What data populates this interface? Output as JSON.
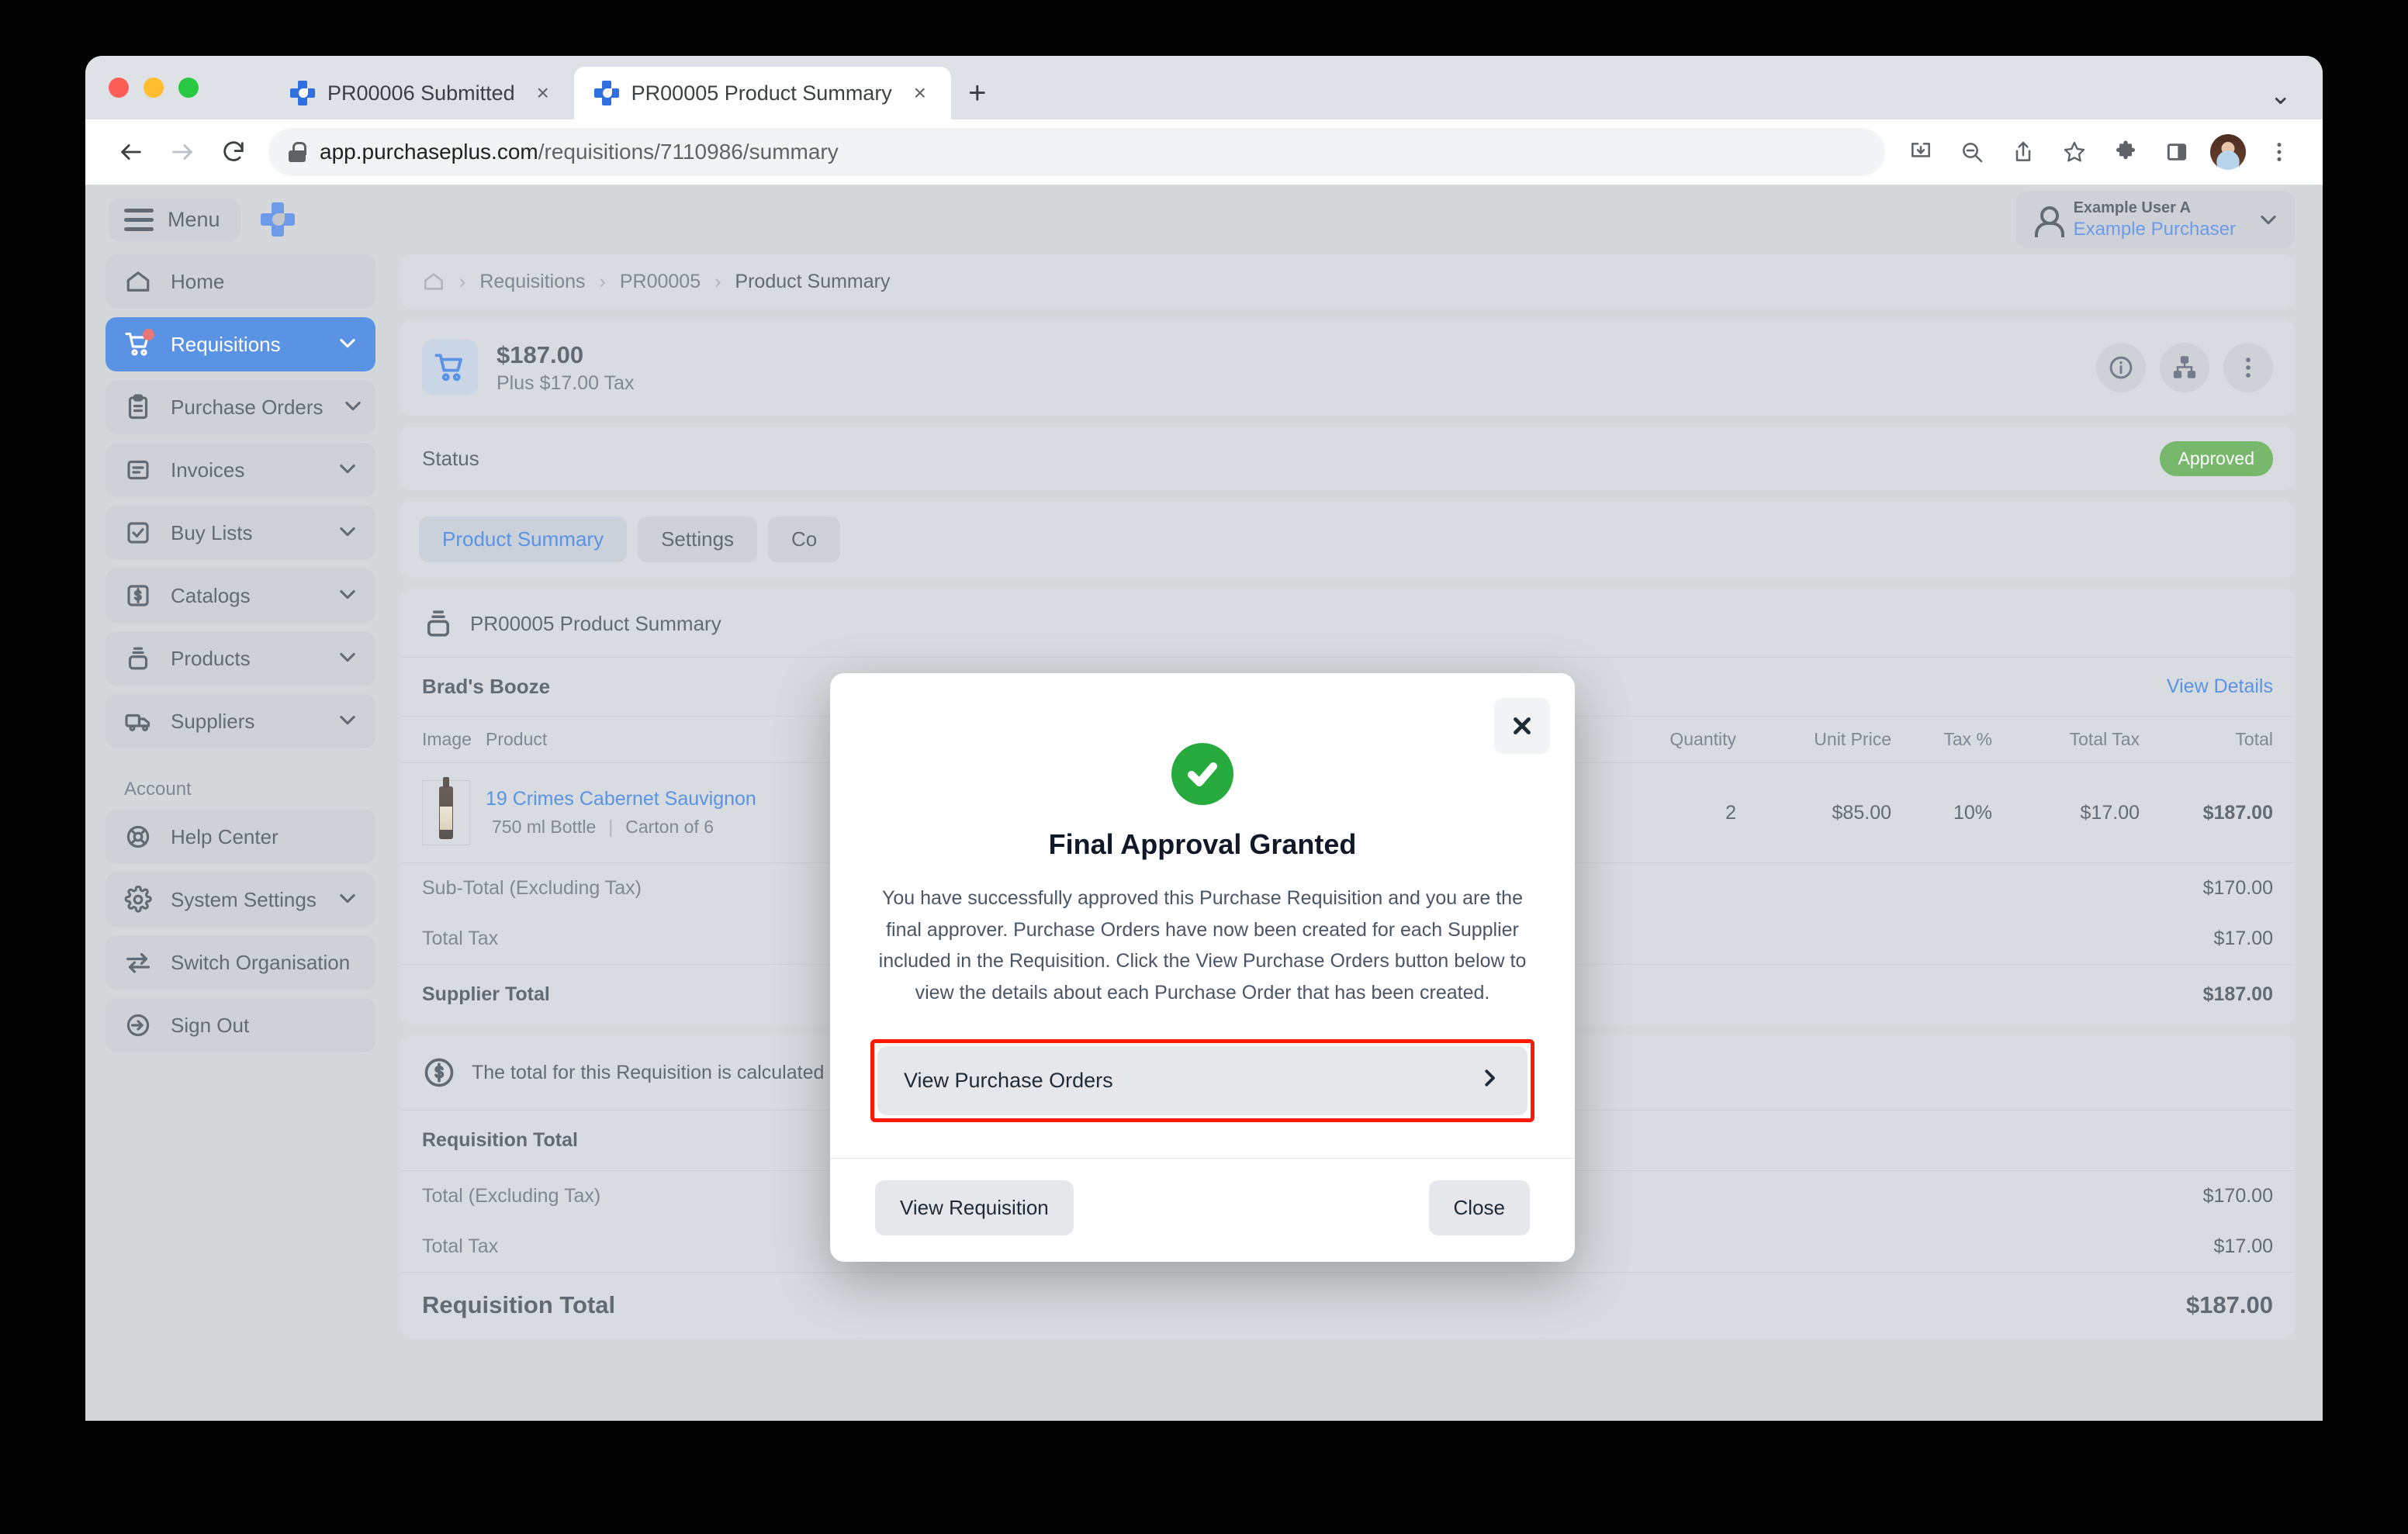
{
  "browser": {
    "tabs": [
      {
        "title": "PR00006 Submitted",
        "active": false,
        "close_label": "×"
      },
      {
        "title": "PR00005 Product Summary",
        "active": true,
        "close_label": "×"
      }
    ],
    "new_tab_label": "+",
    "url_host": "app.purchaseplus.com",
    "url_path": "/requisitions/7110986/summary",
    "toolbar_icons": [
      "install-icon",
      "zoom-out-icon",
      "share-icon",
      "bookmark-star-icon",
      "extensions-puzzle-icon",
      "side-panel-icon",
      "profile-avatar",
      "chrome-menu-icon"
    ],
    "tabstrip_chevron": "⌄"
  },
  "appbar": {
    "menu_label": "Menu",
    "brand": "purchaseplus-logo",
    "user_name": "Example User A",
    "user_role": "Example Purchaser"
  },
  "sidebar": {
    "items": [
      {
        "label": "Home",
        "icon": "home-icon",
        "chevron": false,
        "active": false,
        "badge": false
      },
      {
        "label": "Requisitions",
        "icon": "shopping-cart-icon",
        "chevron": true,
        "active": true,
        "badge": true
      },
      {
        "label": "Purchase Orders",
        "icon": "clipboard-icon",
        "chevron": true,
        "active": false,
        "badge": false
      },
      {
        "label": "Invoices",
        "icon": "document-icon",
        "chevron": true,
        "active": false,
        "badge": false
      },
      {
        "label": "Buy Lists",
        "icon": "check-square-icon",
        "chevron": true,
        "active": false,
        "badge": false
      },
      {
        "label": "Catalogs",
        "icon": "dollar-tag-icon",
        "chevron": true,
        "active": false,
        "badge": false
      },
      {
        "label": "Products",
        "icon": "product-box-icon",
        "chevron": true,
        "active": false,
        "badge": false
      },
      {
        "label": "Suppliers",
        "icon": "truck-icon",
        "chevron": true,
        "active": false,
        "badge": false
      }
    ],
    "account_label": "Account",
    "account_items": [
      {
        "label": "Help Center",
        "icon": "life-ring-icon",
        "chevron": false
      },
      {
        "label": "System Settings",
        "icon": "gear-icon",
        "chevron": true
      },
      {
        "label": "Switch Organisation",
        "icon": "swap-arrows-icon",
        "chevron": false
      },
      {
        "label": "Sign Out",
        "icon": "sign-out-icon",
        "chevron": false
      }
    ]
  },
  "breadcrumb": {
    "home_icon": "home-icon",
    "items": [
      "Requisitions",
      "PR00005",
      "Product Summary"
    ],
    "separator": "›"
  },
  "summary": {
    "icon": "shopping-cart-icon",
    "amount": "$187.00",
    "tax_note": "Plus $17.00 Tax",
    "actions": [
      "info-icon",
      "org-chart-icon",
      "more-vertical-icon"
    ]
  },
  "status": {
    "label": "Status",
    "badge": "Approved",
    "badge_color": "#3d9a2e"
  },
  "tabs": [
    {
      "label": "Product Summary",
      "selected": true
    },
    {
      "label": "Settings",
      "selected": false
    },
    {
      "label": "Co",
      "selected": false
    }
  ],
  "section": {
    "icon": "product-box-icon",
    "title": "PR00005 Product Summary"
  },
  "supplier": {
    "name": "Brad's Booze",
    "view_details": "View Details"
  },
  "table": {
    "headers": [
      "Image",
      "Product",
      "Quantity",
      "Unit Price",
      "Tax %",
      "Total Tax",
      "Total"
    ],
    "rows": [
      {
        "image": "wine-bottle-thumbnail",
        "product": "19 Crimes Cabernet Sauvignon",
        "product_sub_size": "750 ml Bottle",
        "product_sub_pack": "Carton of 6",
        "quantity": "2",
        "unit_price": "$85.00",
        "tax_pct": "10%",
        "total_tax": "$17.00",
        "total": "$187.00"
      }
    ]
  },
  "supplier_totals": [
    {
      "label": "Sub-Total (Excluding Tax)",
      "value": "$170.00",
      "strong": false
    },
    {
      "label": "Total Tax",
      "value": "$17.00",
      "strong": false
    },
    {
      "label": "Supplier Total",
      "value": "$187.00",
      "strong": true
    }
  ],
  "requisition": {
    "note_icon": "dollar-circle-icon",
    "note": "The total for this Requisition is calculated below",
    "heading": "Requisition Total",
    "rows": [
      {
        "label": "Total (Excluding Tax)",
        "value": "$170.00"
      },
      {
        "label": "Total Tax",
        "value": "$17.00"
      }
    ],
    "grand_label": "Requisition Total",
    "grand_value": "$187.00"
  },
  "modal": {
    "close_icon": "close-icon",
    "status_icon": "check-circle-icon",
    "title": "Final Approval Granted",
    "body": "You have successfully approved this Purchase Requisition and you are the final approver. Purchase Orders have now been created for each Supplier included in the Requisition. Click the View Purchase Orders button below to view the details about each Purchase Order that has been created.",
    "primary_label": "View Purchase Orders",
    "primary_chevron": "chevron-right-icon",
    "highlight_color": "#ff1a00",
    "secondary_label": "View Requisition",
    "close_label": "Close"
  }
}
